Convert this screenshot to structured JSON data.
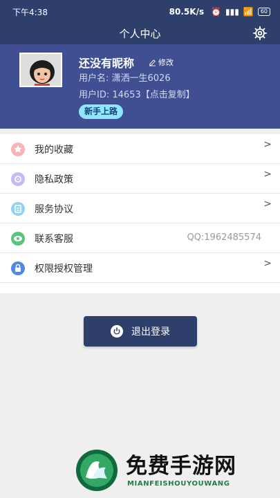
{
  "status_bar": {
    "time": "下午4:38",
    "network_speed": "80.5K/s",
    "battery": "60"
  },
  "header": {
    "title": "个人中心"
  },
  "profile": {
    "nickname": "还没有昵称",
    "edit_label": "修改",
    "username_label": "用户名: 潇洒一生6026",
    "user_id_label": "用户ID: 14653【点击复制】",
    "newbie_badge": "新手上路"
  },
  "menu": {
    "items": [
      {
        "label": "我的收藏",
        "icon": "star-icon",
        "color": "#f28c8c",
        "arrow": ">"
      },
      {
        "label": "隐私政策",
        "icon": "privacy-icon",
        "color": "#b7a5f0",
        "arrow": ">"
      },
      {
        "label": "服务协议",
        "icon": "agreement-icon",
        "color": "#72c9e9",
        "arrow": ">"
      },
      {
        "label": "联系客服",
        "icon": "support-icon",
        "color": "#2fb35a",
        "value": "QQ:1962485574"
      },
      {
        "label": "权限授权管理",
        "icon": "lock-icon",
        "color": "#4b86e6",
        "arrow": ">"
      }
    ]
  },
  "logout": {
    "label": "退出登录"
  },
  "watermark": {
    "title": "免费手游网",
    "subtitle": "MIANFEISHOUYOUWANG"
  }
}
